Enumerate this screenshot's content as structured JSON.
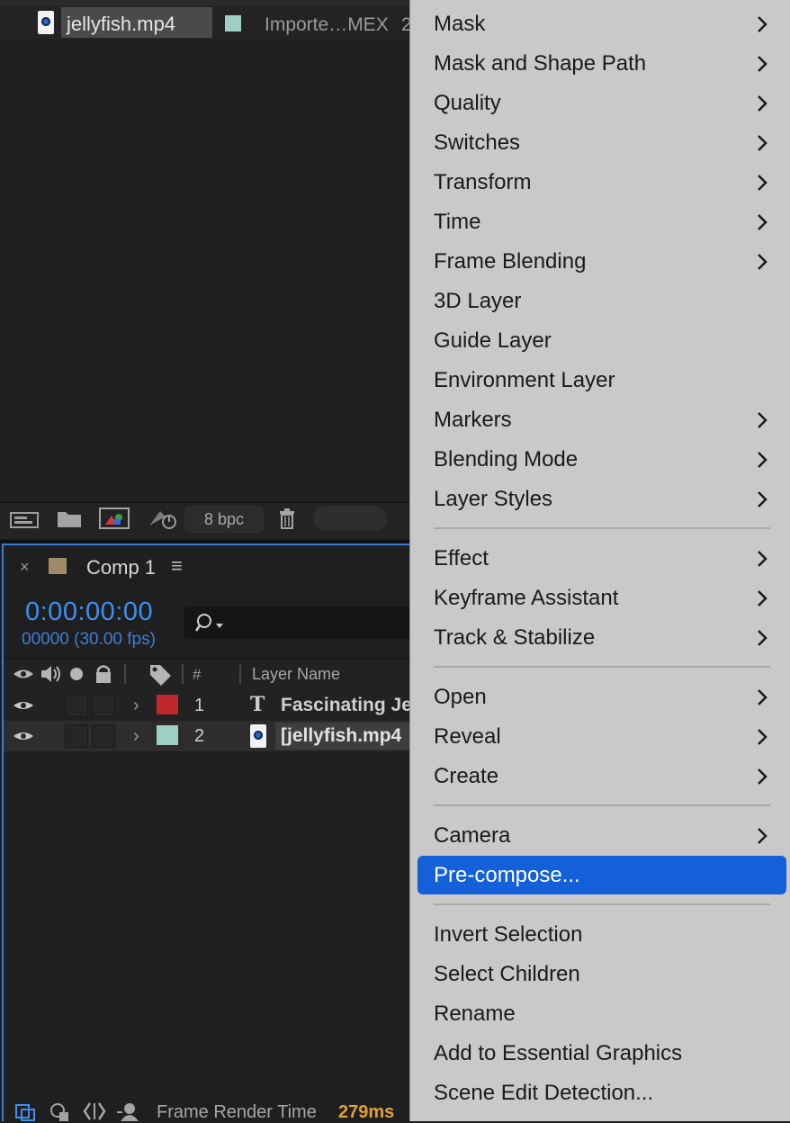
{
  "project": {
    "row": {
      "filename": "jellyfish.mp4",
      "type": "Importe…MEX",
      "extra": "2",
      "label_color": "#9fcfc4"
    },
    "footer": {
      "bpc_label": "8 bpc"
    }
  },
  "timeline": {
    "tab": {
      "close": "×",
      "title": "Comp 1",
      "menu_icon": "≡",
      "swatch_color": "#a08a6a"
    },
    "timecode": "0:00:00:00",
    "frame_info": "00000 (30.00 fps)",
    "search": {
      "placeholder": ""
    },
    "headers": {
      "num": "#",
      "layer_name": "Layer Name"
    },
    "layers": [
      {
        "num": "1",
        "type_icon": "T",
        "name": "Fascinating Je",
        "color": "#c0262b"
      },
      {
        "num": "2",
        "type_icon": "file-icon",
        "name": "[jellyfish.mp4",
        "color": "#9fcfc4"
      }
    ],
    "status": {
      "label": "Frame Render Time",
      "value": "279ms"
    }
  },
  "menu": {
    "items": [
      {
        "label": "Mask",
        "submenu": true
      },
      {
        "label": "Mask and Shape Path",
        "submenu": true
      },
      {
        "label": "Quality",
        "submenu": true
      },
      {
        "label": "Switches",
        "submenu": true
      },
      {
        "label": "Transform",
        "submenu": true
      },
      {
        "label": "Time",
        "submenu": true
      },
      {
        "label": "Frame Blending",
        "submenu": true
      },
      {
        "label": "3D Layer",
        "submenu": false
      },
      {
        "label": "Guide Layer",
        "submenu": false
      },
      {
        "label": "Environment Layer",
        "submenu": false
      },
      {
        "label": "Markers",
        "submenu": true
      },
      {
        "label": "Blending Mode",
        "submenu": true
      },
      {
        "label": "Layer Styles",
        "submenu": true
      },
      {
        "label": "Effect",
        "submenu": true
      },
      {
        "label": "Keyframe Assistant",
        "submenu": true
      },
      {
        "label": "Track & Stabilize",
        "submenu": true
      },
      {
        "label": "Open",
        "submenu": true
      },
      {
        "label": "Reveal",
        "submenu": true
      },
      {
        "label": "Create",
        "submenu": true
      },
      {
        "label": "Camera",
        "submenu": true
      },
      {
        "label": "Pre-compose...",
        "submenu": false,
        "highlighted": true
      },
      {
        "label": "Invert Selection",
        "submenu": false
      },
      {
        "label": "Select Children",
        "submenu": false
      },
      {
        "label": "Rename",
        "submenu": false
      },
      {
        "label": "Add to Essential Graphics",
        "submenu": false
      },
      {
        "label": "Scene Edit Detection...",
        "submenu": false
      }
    ],
    "highlight_color": "#1460d8"
  }
}
